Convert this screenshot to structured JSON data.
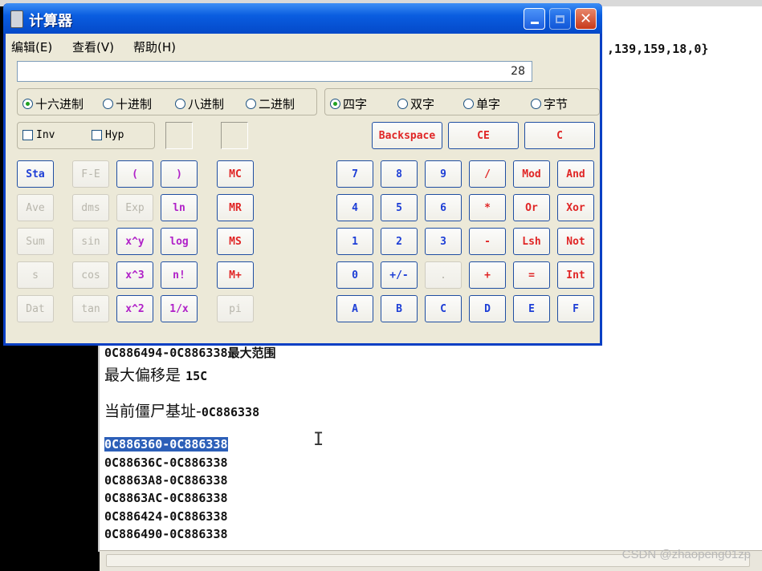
{
  "editor": {
    "top_right_text": ",139,159,18,0}",
    "range_line": "0C886494-0C886338最大范围",
    "max_offset_label": "最大偏移是",
    "max_offset_value": "15C",
    "zombie_base_label": "当前僵尸基址-",
    "zombie_base_value": "0C886338",
    "code_lines": [
      "0C886360-0C886338",
      "0C88636C-0C886338",
      "0C8863A8-0C886338",
      "0C8863AC-0C886338",
      "0C886424-0C886338",
      "0C886490-0C886338"
    ],
    "cursor_glyph": "I"
  },
  "watermark": "CSDN @zhaopeng01zp",
  "calculator": {
    "title": "计算器",
    "menu": [
      "编辑(E)",
      "查看(V)",
      "帮助(H)"
    ],
    "display_value": "28",
    "base_modes": [
      {
        "label": "十六进制",
        "selected": true
      },
      {
        "label": "十进制",
        "selected": false
      },
      {
        "label": "八进制",
        "selected": false
      },
      {
        "label": "二进制",
        "selected": false
      }
    ],
    "word_sizes": [
      {
        "label": "四字",
        "selected": true
      },
      {
        "label": "双字",
        "selected": false
      },
      {
        "label": "单字",
        "selected": false
      },
      {
        "label": "字节",
        "selected": false
      }
    ],
    "checkboxes": [
      "Inv",
      "Hyp"
    ],
    "edit_buttons": [
      "Backspace",
      "CE",
      "C"
    ],
    "stat_buttons": [
      "Sta",
      "Ave",
      "Sum",
      "s",
      "Dat"
    ],
    "sci_col1": [
      "F-E",
      "dms",
      "sin",
      "cos",
      "tan"
    ],
    "sci_col2": [
      "(",
      "Exp",
      "x^y",
      "x^3",
      "x^2"
    ],
    "sci_col3": [
      ")",
      "ln",
      "log",
      "n!",
      "1/x"
    ],
    "memory_buttons": [
      "MC",
      "MR",
      "MS",
      "M+",
      "pi"
    ],
    "keypad": [
      [
        "7",
        "8",
        "9",
        "/",
        "Mod",
        "And"
      ],
      [
        "4",
        "5",
        "6",
        "*",
        "Or",
        "Xor"
      ],
      [
        "1",
        "2",
        "3",
        "-",
        "Lsh",
        "Not"
      ],
      [
        "0",
        "+/-",
        ".",
        "+",
        "=",
        "Int"
      ],
      [
        "A",
        "B",
        "C",
        "D",
        "E",
        "F"
      ]
    ],
    "colors": {
      "operator_red": "#e02525",
      "digit_blue": "#1d3ed6",
      "function_purple": "#b020c8",
      "disabled_gray": "#b8b6ac",
      "titlebar_blue": "#0a5de0"
    }
  }
}
